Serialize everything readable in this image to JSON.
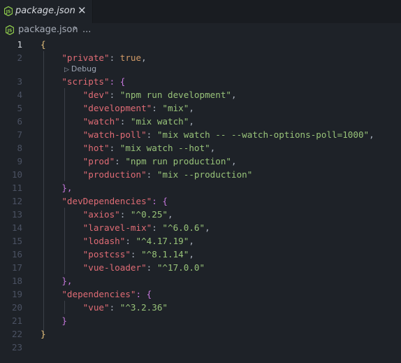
{
  "tab": {
    "filename": "package.json",
    "close_glyph": "✕",
    "icon": "nodejs-hexagon-icon"
  },
  "breadcrumb": {
    "file": "package.json",
    "separator": "›",
    "ellipsis": "..."
  },
  "codelens": {
    "label": "Debug",
    "icon": "play-triangle-icon"
  },
  "active_line": 1,
  "line_numbers": [
    "1",
    "2",
    "3",
    "4",
    "5",
    "6",
    "7",
    "8",
    "9",
    "10",
    "11",
    "12",
    "13",
    "14",
    "15",
    "16",
    "17",
    "18",
    "19",
    "20",
    "21",
    "22",
    "23"
  ],
  "code": {
    "l1_open": "{",
    "private_key": "\"private\"",
    "private_colon": ": ",
    "private_val": "true",
    "private_comma": ",",
    "scripts_key": "\"scripts\"",
    "scripts_open": ": {",
    "dev_key": "\"dev\"",
    "dev_val": "\"npm run development\"",
    "development_key": "\"development\"",
    "development_val": "\"mix\"",
    "watch_key": "\"watch\"",
    "watch_val": "\"mix watch\"",
    "watchpoll_key": "\"watch-poll\"",
    "watchpoll_val": "\"mix watch -- --watch-options-poll=1000\"",
    "hot_key": "\"hot\"",
    "hot_val": "\"mix watch --hot\"",
    "prod_key": "\"prod\"",
    "prod_val": "\"npm run production\"",
    "production_key": "\"production\"",
    "production_val": "\"mix --production\"",
    "scripts_close": "},",
    "devdeps_key": "\"devDependencies\"",
    "devdeps_open": ": {",
    "axios_key": "\"axios\"",
    "axios_val": "\"^0.25\"",
    "laravelmix_key": "\"laravel-mix\"",
    "laravelmix_val": "\"^6.0.6\"",
    "lodash_key": "\"lodash\"",
    "lodash_val": "\"^4.17.19\"",
    "postcss_key": "\"postcss\"",
    "postcss_val": "\"^8.1.14\"",
    "vueloader_key": "\"vue-loader\"",
    "vueloader_val": "\"^17.0.0\"",
    "devdeps_close": "},",
    "deps_key": "\"dependencies\"",
    "deps_open": ": {",
    "vue_key": "\"vue\"",
    "vue_val": "\"^3.2.36\"",
    "deps_close": "}",
    "root_close": "}",
    "colon": ": ",
    "comma": ","
  },
  "colors": {
    "background": "#1e2228",
    "key": "#e06c75",
    "string": "#98c379",
    "bracket_level1": "#e5c07b",
    "bracket_level2": "#c678dd",
    "bracket_level3": "#61afef",
    "boolean": "#d19a66",
    "node_icon": "#8cc84b"
  }
}
